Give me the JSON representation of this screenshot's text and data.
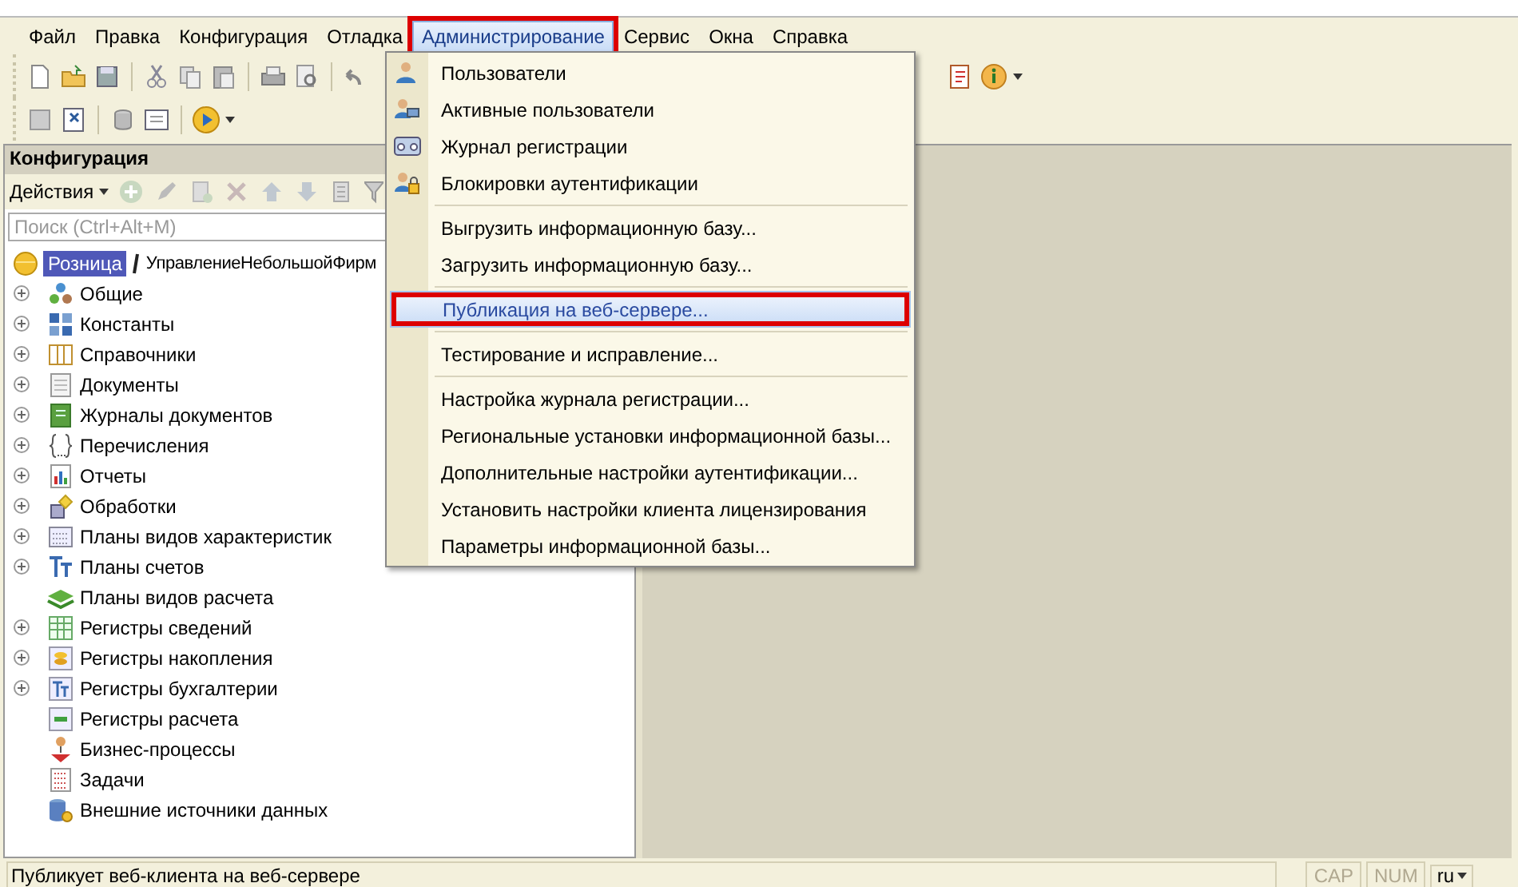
{
  "menu_bar": {
    "items": [
      {
        "label": "Файл",
        "selected": false,
        "outlined": false
      },
      {
        "label": "Правка",
        "selected": false,
        "outlined": false
      },
      {
        "label": "Конфигурация",
        "selected": false,
        "outlined": false
      },
      {
        "label": "Отладка",
        "selected": false,
        "outlined": false
      },
      {
        "label": "Администрирование",
        "selected": true,
        "outlined": true
      },
      {
        "label": "Сервис",
        "selected": false,
        "outlined": false
      },
      {
        "label": "Окна",
        "selected": false,
        "outlined": false
      },
      {
        "label": "Справка",
        "selected": false,
        "outlined": false
      }
    ]
  },
  "config_panel": {
    "title": "Конфигурация",
    "actions": "Действия",
    "search": {
      "placeholder": "Поиск (Ctrl+Alt+M)"
    },
    "root": {
      "name": "Розница",
      "synonym": "УправлениеНебольшойФирм"
    },
    "tree": [
      {
        "label": "Общие",
        "expandable": true
      },
      {
        "label": "Константы",
        "expandable": true
      },
      {
        "label": "Справочники",
        "expandable": true
      },
      {
        "label": "Документы",
        "expandable": true
      },
      {
        "label": "Журналы документов",
        "expandable": true
      },
      {
        "label": "Перечисления",
        "expandable": true
      },
      {
        "label": "Отчеты",
        "expandable": true
      },
      {
        "label": "Обработки",
        "expandable": true
      },
      {
        "label": "Планы видов характеристик",
        "expandable": true
      },
      {
        "label": "Планы счетов",
        "expandable": true
      },
      {
        "label": "Планы видов расчета",
        "expandable": false
      },
      {
        "label": "Регистры сведений",
        "expandable": true
      },
      {
        "label": "Регистры накопления",
        "expandable": true
      },
      {
        "label": "Регистры бухгалтерии",
        "expandable": true
      },
      {
        "label": "Регистры расчета",
        "expandable": false
      },
      {
        "label": "Бизнес-процессы",
        "expandable": false
      },
      {
        "label": "Задачи",
        "expandable": false
      },
      {
        "label": "Внешние источники данных",
        "expandable": false
      }
    ]
  },
  "admin_menu": {
    "groups": [
      [
        {
          "label": "Пользователи",
          "selected": false,
          "outlined": false
        },
        {
          "label": "Активные пользователи",
          "selected": false,
          "outlined": false
        },
        {
          "label": "Журнал регистрации",
          "selected": false,
          "outlined": false
        },
        {
          "label": "Блокировки аутентификации",
          "selected": false,
          "outlined": false
        }
      ],
      [
        {
          "label": "Выгрузить информационную базу...",
          "selected": false,
          "outlined": false
        },
        {
          "label": "Загрузить информационную базу...",
          "selected": false,
          "outlined": false
        }
      ],
      [
        {
          "label": "Публикация на веб-сервере...",
          "selected": true,
          "outlined": true
        }
      ],
      [
        {
          "label": "Тестирование и исправление...",
          "selected": false,
          "outlined": false
        }
      ],
      [
        {
          "label": "Настройка журнала регистрации...",
          "selected": false,
          "outlined": false
        },
        {
          "label": "Региональные установки информационной базы...",
          "selected": false,
          "outlined": false
        },
        {
          "label": "Дополнительные настройки аутентификации...",
          "selected": false,
          "outlined": false
        },
        {
          "label": "Установить настройки клиента лицензирования",
          "selected": false,
          "outlined": false
        },
        {
          "label": "Параметры информационной базы...",
          "selected": false,
          "outlined": false
        }
      ]
    ]
  },
  "status_bar": {
    "message": "Публикует веб-клиента на веб-сервере",
    "indicators": [
      "CAP",
      "NUM"
    ],
    "language": "ru"
  }
}
